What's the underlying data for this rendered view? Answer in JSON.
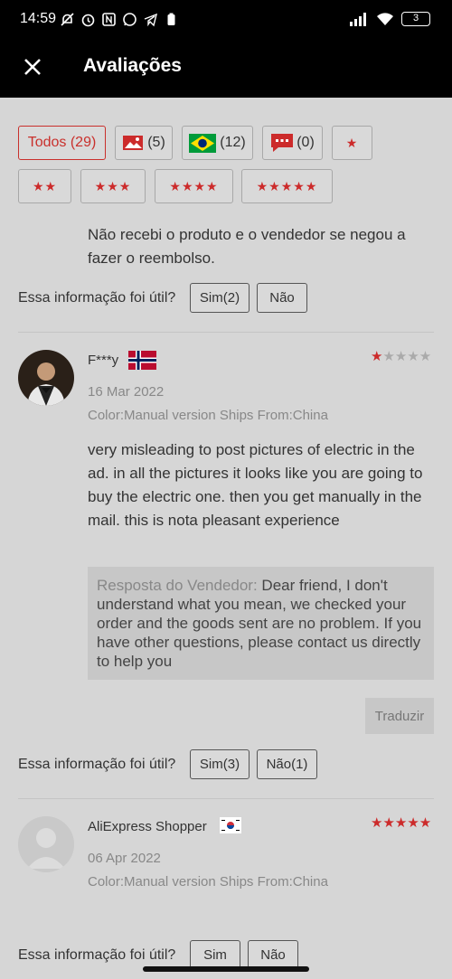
{
  "status": {
    "time": "14:59",
    "battery": "3"
  },
  "header": {
    "title": "Avaliações"
  },
  "filters": {
    "all": "Todos (29)",
    "photo_count": "(5)",
    "country_count": "(12)",
    "comment_count": "(0)",
    "star1": "★",
    "star2": "★★",
    "star3": "★★★",
    "star4": "★★★★",
    "star5": "★★★★★"
  },
  "review0": {
    "text": "Não recebi o produto e o vendedor se negou a fazer o reembolso.",
    "helpful_q": "Essa informação foi útil?",
    "yes": "Sim(2)",
    "no": "Não"
  },
  "review1": {
    "user": "F***y",
    "date": "16 Mar 2022",
    "meta": "Color:Manual version Ships From:China",
    "text": "very misleading to post pictures of electric in the ad.  in all the pictures it looks like you are going to buy the electric one.  then you get manually in the mail.  this is nota pleasant experience",
    "reply_label": "Resposta do Vendedor:",
    "reply_text": " Dear friend, I don't understand what you mean, we checked your order and the goods sent are no problem. If you have other questions, please contact us directly to help you",
    "translate": "Traduzir",
    "helpful_q": "Essa informação foi útil?",
    "yes": "Sim(3)",
    "no": "Não(1)",
    "rating": 1
  },
  "review2": {
    "user": "AliExpress Shopper",
    "date": "06 Apr 2022",
    "meta": "Color:Manual version Ships From:China",
    "helpful_q": "Essa informação foi útil?",
    "yes": "Sim",
    "no": "Não",
    "rating": 5
  },
  "colors": {
    "accent": "#c9302c",
    "background": "#d6d6d6"
  }
}
